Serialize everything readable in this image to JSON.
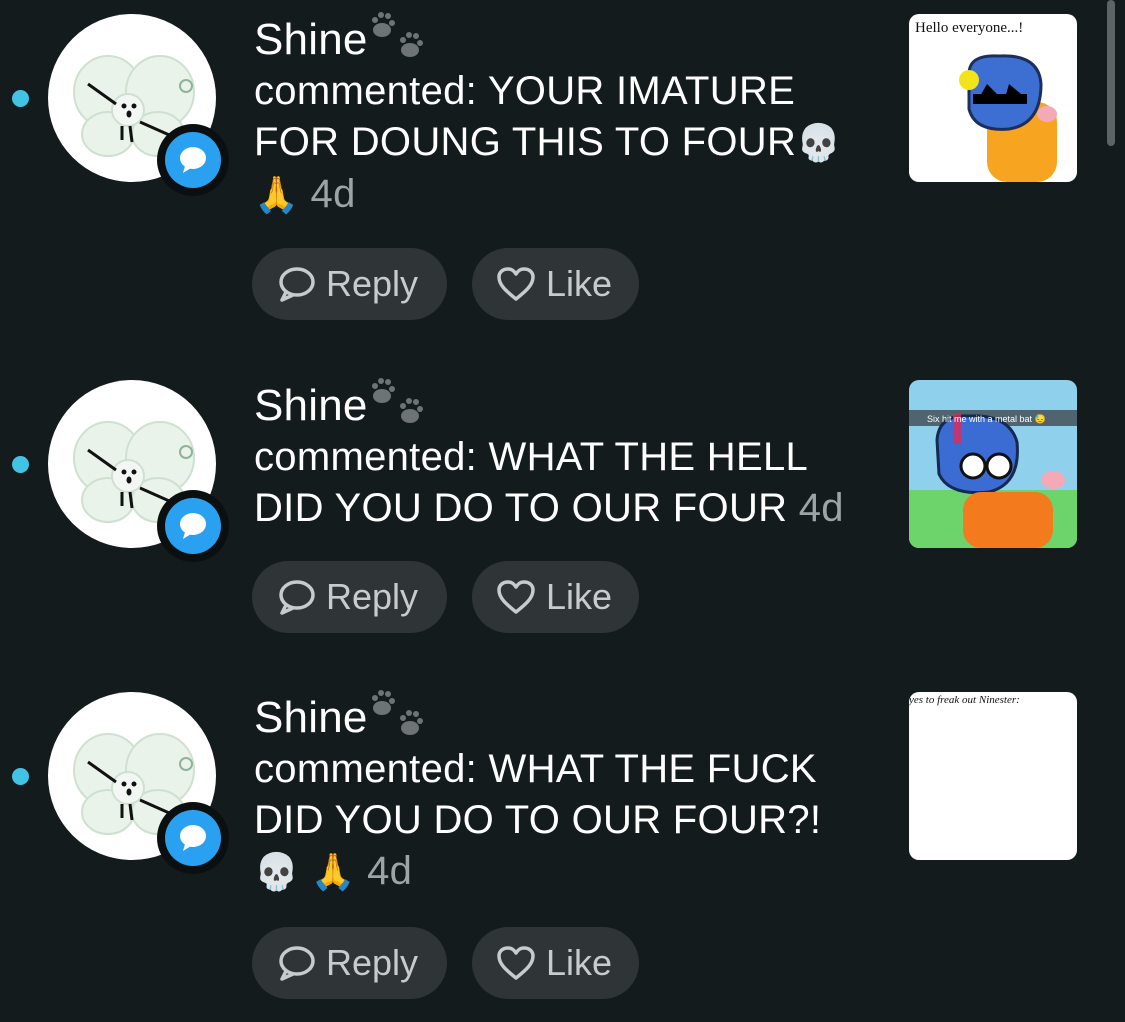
{
  "notifications": [
    {
      "username": "Shine",
      "action": "commented:",
      "line1": "YOUR IMATURE",
      "line2": "FOR DOUNG THIS TO FOUR",
      "line3_emoji": "🙏",
      "line2_emoji": "💀",
      "time": "4d",
      "thumb_caption": "Hello everyone...!"
    },
    {
      "username": "Shine",
      "action": "commented:",
      "line1": "WHAT THE HELL",
      "line2": "DID YOU DO TO OUR FOUR",
      "time": "4d",
      "thumb_caption": "Six hit me with a metal bat 😓"
    },
    {
      "username": "Shine",
      "action": "commented:",
      "line1": "WHAT THE FUCK",
      "line2": "DID YOU DO TO OUR FOUR?!",
      "line3_emoji1": "💀",
      "line3_emoji2": "🙏",
      "time": "4d",
      "thumb_caption": "yes to freak out Ninester:"
    }
  ],
  "buttons": {
    "reply": "Reply",
    "like": "Like"
  },
  "colors": {
    "background": "#141b1d",
    "unread_dot": "#41c3e6",
    "badge": "#2aa0f0",
    "pill": "#2f3437"
  },
  "icons": {
    "badge": "comment-bubble-icon",
    "reply": "speech-bubble-icon",
    "like": "heart-outline-icon",
    "name_decor": "paw-prints-icon"
  }
}
